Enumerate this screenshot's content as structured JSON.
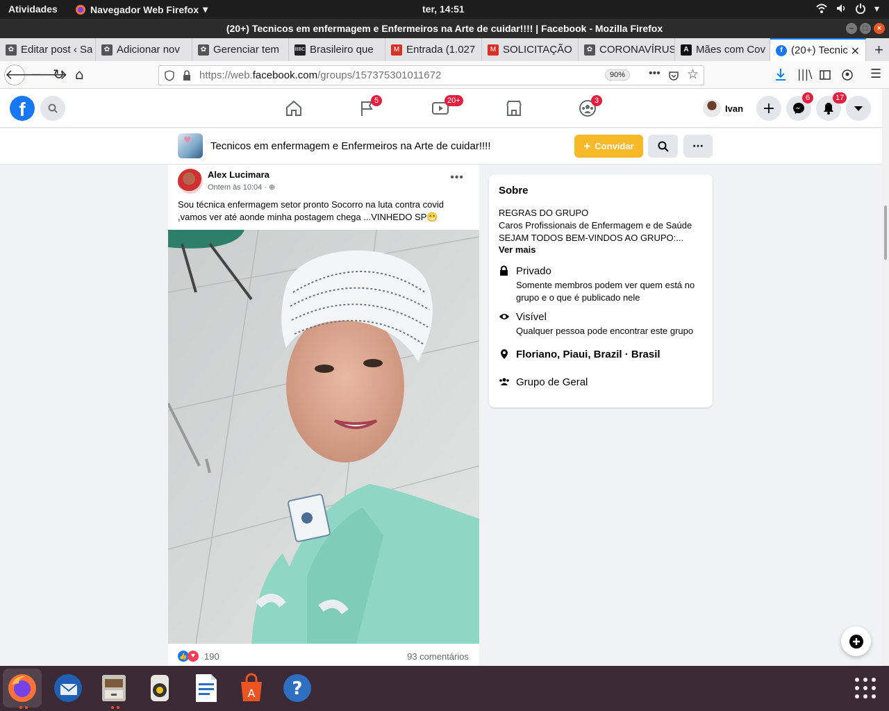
{
  "system_bar": {
    "activities": "Atividades",
    "app_name": "Navegador Web Firefox",
    "clock": "ter, 14:51"
  },
  "window": {
    "title": "(20+) Tecnicos em enfermagem e Enfermeiros na Arte de cuidar!!!! | Facebook - Mozilla Firefox"
  },
  "tabs": [
    {
      "label": "Editar post ‹ Sa"
    },
    {
      "label": "Adicionar nov"
    },
    {
      "label": "Gerenciar tem"
    },
    {
      "label": "Brasileiro que"
    },
    {
      "label": "Entrada (1.027"
    },
    {
      "label": "SOLICITAÇÃO"
    },
    {
      "label": "CORONAVÍRUS"
    },
    {
      "label": "Mães com Cov"
    },
    {
      "label": "(20+) Tecnic"
    }
  ],
  "url_bar": {
    "prefix": "https://web.",
    "domain": "facebook.com",
    "path": "/groups/157375301011672",
    "zoom": "90%"
  },
  "fb_header": {
    "badges": {
      "pages": "5",
      "watch": "20+",
      "groups": "3",
      "messenger": "6",
      "notifications": "17"
    },
    "user_name": "Ivan"
  },
  "group": {
    "name": "Tecnicos em enfermagem e Enfermeiros na Arte de cuidar!!!!",
    "invite_label": "Convidar"
  },
  "post": {
    "author": "Alex Lucimara",
    "time": "Ontem às 10:04 · ",
    "text": "Sou técnica enfermagem setor pronto Socorro  na luta contra  covid ,vamos ver até aonde minha postagem chega ...VINHEDO SP😁",
    "reactions_count": "190",
    "comments_count": "93 comentários"
  },
  "about": {
    "heading": "Sobre",
    "description": "REGRAS DO GRUPO\nCaros Profissionais de Enfermagem e de Saúde\nSEJAM TODOS BEM-VINDOS AO GRUPO:...",
    "see_more": "Ver mais",
    "private_title": "Privado",
    "private_desc": "Somente membros podem ver quem está no grupo e o que é publicado nele",
    "visible_title": "Visível",
    "visible_desc": "Qualquer pessoa pode encontrar este grupo",
    "location": "Floriano, Piaui, Brazil · Brasil",
    "category": "Grupo de Geral"
  },
  "colors": {
    "fb_blue": "#1877f2",
    "invite_yellow": "#f7b928",
    "badge_red": "#e41e3f",
    "ubuntu_orange": "#e95420"
  }
}
